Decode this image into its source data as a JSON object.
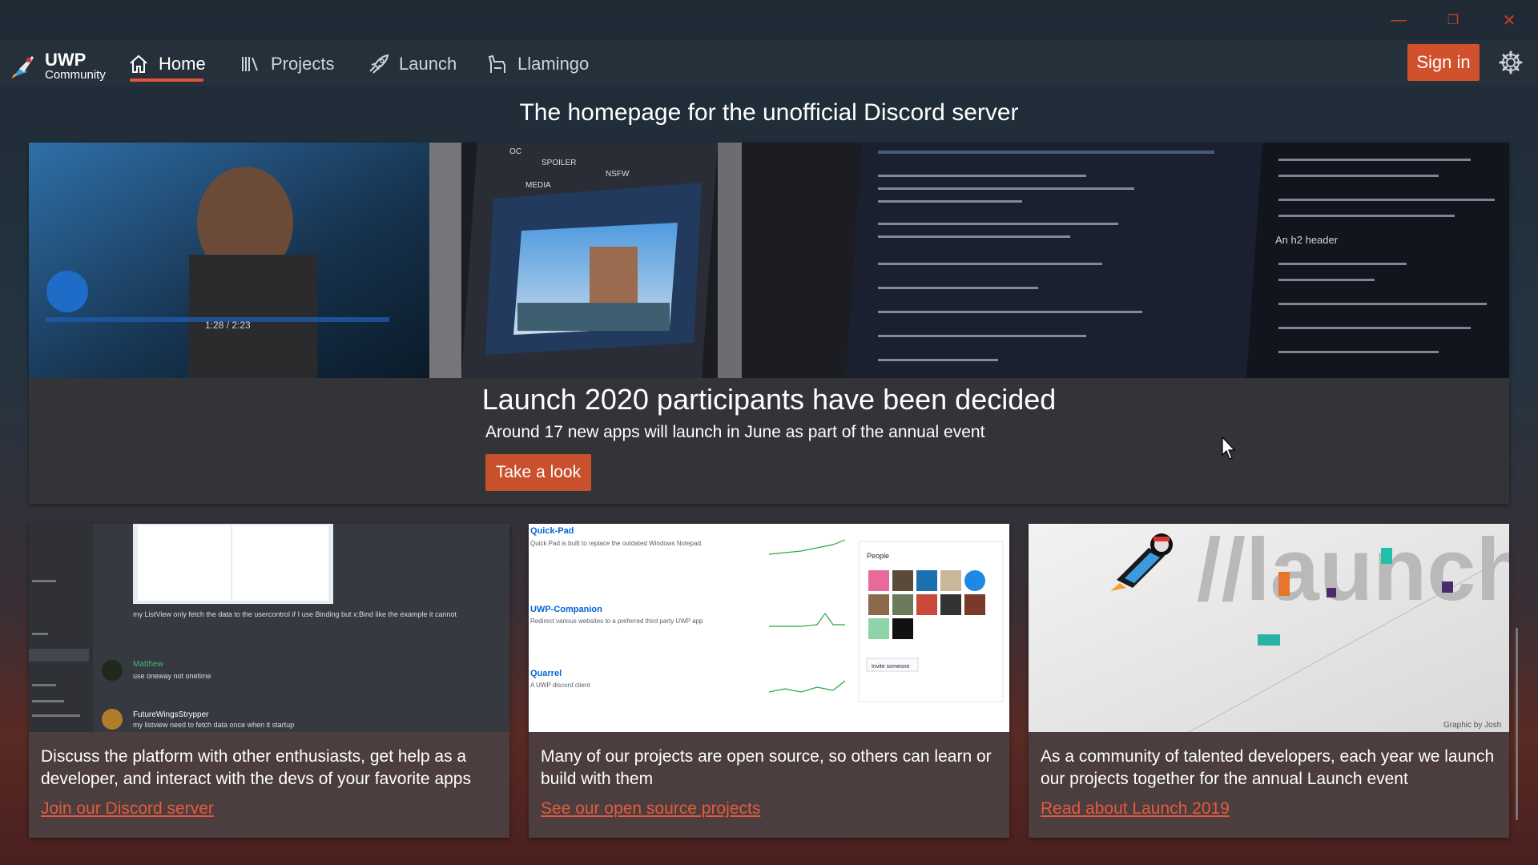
{
  "window": {
    "minimize_glyph": "—",
    "restore_glyph": "❐",
    "close_glyph": "✕"
  },
  "brand": {
    "title": "UWP",
    "subtitle": "Community"
  },
  "nav": [
    {
      "label": "Home",
      "icon": "home-icon",
      "active": true
    },
    {
      "label": "Projects",
      "icon": "books-icon",
      "active": false
    },
    {
      "label": "Launch",
      "icon": "rocket-icon",
      "active": false
    },
    {
      "label": "Llamingo",
      "icon": "llama-icon",
      "active": false
    }
  ],
  "sign_in_label": "Sign in",
  "headline": "The homepage for the unofficial Discord server",
  "hero": {
    "title": "Launch 2020 participants have been decided",
    "subtitle": "Around 17 new apps will launch in June as part of the annual event",
    "button_label": "Take a look",
    "player_time": "1:28 / 2:23",
    "editor_heading": "An h2 header",
    "tags": [
      "OC",
      "SPOILER",
      "NSFW",
      "MEDIA"
    ]
  },
  "cards": [
    {
      "text": "Discuss the platform with other enthusiasts, get help as a developer, and interact with the devs of your favorite apps",
      "link": "Join our Discord server",
      "chat": [
        {
          "user": "Matthew",
          "msg": "use oneway not onetime"
        },
        {
          "user": "FutureWingsStrypper",
          "msg": "my listview need to fetch data once when it startup"
        }
      ],
      "top_msg": "my ListView only fetch the data to the usercontrol if I use Binding but x:Bind like the example it cannot"
    },
    {
      "text": "Many of our projects are open source, so others can learn or build with them",
      "link": "See our open source projects",
      "repos": [
        {
          "name": "Quick-Pad",
          "desc": "Quick Pad is built to replace the outdated Windows Notepad."
        },
        {
          "name": "UWP-Companion",
          "desc": "Redirect various websites to a preferred third party UWP app"
        },
        {
          "name": "Quarrel",
          "desc": "A UWP discord client"
        }
      ],
      "people_label": "People",
      "invite_label": "Invite someone"
    },
    {
      "text": "As a community of talented developers, each year we launch our projects together for the annual Launch event",
      "link": "Read about Launch 2019",
      "graphic_text": "//launch",
      "credit": "Graphic by Josh"
    }
  ],
  "colors": {
    "accent": "#d2512d",
    "link": "#e35b3e",
    "navbar": "#25303b"
  }
}
